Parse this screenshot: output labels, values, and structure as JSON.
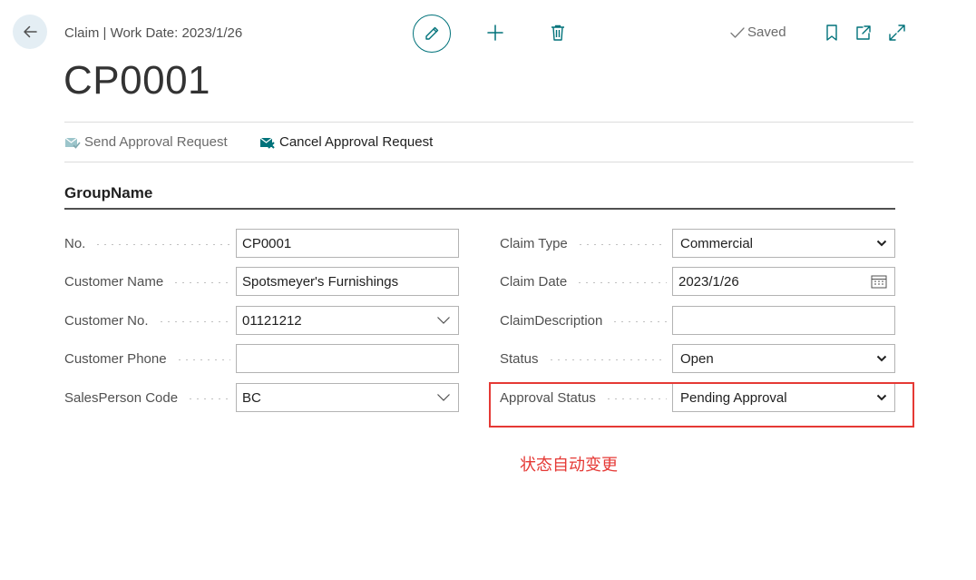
{
  "header": {
    "breadcrumb": "Claim | Work Date: 2023/1/26",
    "saved_label": "Saved"
  },
  "page_title": "CP0001",
  "actions": {
    "send": "Send Approval Request",
    "cancel": "Cancel Approval Request"
  },
  "group_name": "GroupName",
  "fields": {
    "no": {
      "label": "No.",
      "value": "CP0001"
    },
    "customer_name": {
      "label": "Customer Name",
      "value": "Spotsmeyer's Furnishings"
    },
    "customer_no": {
      "label": "Customer No.",
      "value": "01121212"
    },
    "customer_phone": {
      "label": "Customer Phone",
      "value": ""
    },
    "salesperson_code": {
      "label": "SalesPerson Code",
      "value": "BC"
    },
    "claim_type": {
      "label": "Claim Type",
      "value": "Commercial"
    },
    "claim_date": {
      "label": "Claim Date",
      "value": "2023/1/26"
    },
    "claim_description": {
      "label": "ClaimDescription",
      "value": ""
    },
    "status": {
      "label": "Status",
      "value": "Open"
    },
    "approval_status": {
      "label": "Approval Status",
      "value": "Pending Approval"
    }
  },
  "annotation": "状态自动变更",
  "colors": {
    "accent": "#00727a",
    "annotation_red": "#e53935",
    "back_bg": "#e4eef4"
  },
  "icons": [
    "back-arrow-icon",
    "pencil-icon",
    "plus-icon",
    "trash-icon",
    "checkmark-icon",
    "bookmark-icon",
    "open-new-window-icon",
    "expand-icon",
    "send-approval-icon",
    "cancel-approval-icon",
    "chevron-down-icon",
    "calendar-icon"
  ]
}
